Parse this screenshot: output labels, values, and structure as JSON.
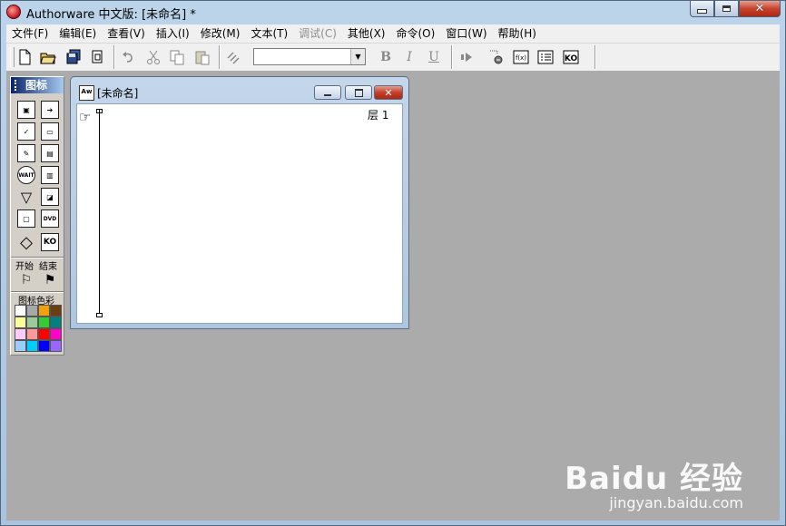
{
  "window": {
    "title": "Authorware 中文版: [未命名] *",
    "controls": {
      "minimize": "minimize",
      "maximize": "maximize",
      "close": "close"
    }
  },
  "menu": [
    {
      "label": "文件(F)",
      "enabled": true
    },
    {
      "label": "编辑(E)",
      "enabled": true
    },
    {
      "label": "查看(V)",
      "enabled": true
    },
    {
      "label": "插入(I)",
      "enabled": true
    },
    {
      "label": "修改(M)",
      "enabled": true
    },
    {
      "label": "文本(T)",
      "enabled": true
    },
    {
      "label": "调试(C)",
      "enabled": false
    },
    {
      "label": "其他(X)",
      "enabled": true
    },
    {
      "label": "命令(O)",
      "enabled": true
    },
    {
      "label": "窗口(W)",
      "enabled": true
    },
    {
      "label": "帮助(H)",
      "enabled": true
    }
  ],
  "toolbar": {
    "buttons": [
      "new-icon",
      "open-icon",
      "save-all-icon",
      "import-icon",
      "undo-icon",
      "cut-icon",
      "copy-icon",
      "paste-icon",
      "find-icon"
    ],
    "style_combo_value": "",
    "format_buttons": {
      "bold": "B",
      "italic": "I",
      "underline": "U"
    },
    "right_buttons": [
      "run-icon",
      "control-panel-icon",
      "functions-icon",
      "variables-icon",
      "knowledge-objects-icon"
    ],
    "right_labels": {
      "functions": "f(x)",
      "knowledge_objects": "KO"
    }
  },
  "icon_palette": {
    "title": "图标",
    "icons": [
      "display-icon",
      "motion-icon",
      "erase-icon",
      "wait-icon",
      "navigate-icon",
      "framework-icon",
      "decision-icon",
      "interaction-icon",
      "calculate-icon",
      "map-icon",
      "digital-movie-icon",
      "sound-icon",
      "dvd-icon",
      "ko-icon"
    ],
    "icon_labels": {
      "wait": "WAIT",
      "dvd": "DVD",
      "ko": "KO"
    },
    "flag_labels": {
      "start": "开始",
      "end": "结束"
    },
    "color_label": "图标色彩",
    "colors": [
      "#ffffff",
      "#a8a8a8",
      "#f2a10a",
      "#6b3e10",
      "#ffff99",
      "#99cc99",
      "#33cc33",
      "#008080",
      "#ffccff",
      "#ff9999",
      "#ff0000",
      "#ff00cc",
      "#99ccff",
      "#00ccff",
      "#0000ff",
      "#9966ff"
    ]
  },
  "flowline_window": {
    "title": "[未命名]",
    "layer_label": "层 1",
    "icon_label": "Aw"
  },
  "watermark": {
    "logo": "Baidu 经验",
    "url": "jingyan.baidu.com"
  }
}
